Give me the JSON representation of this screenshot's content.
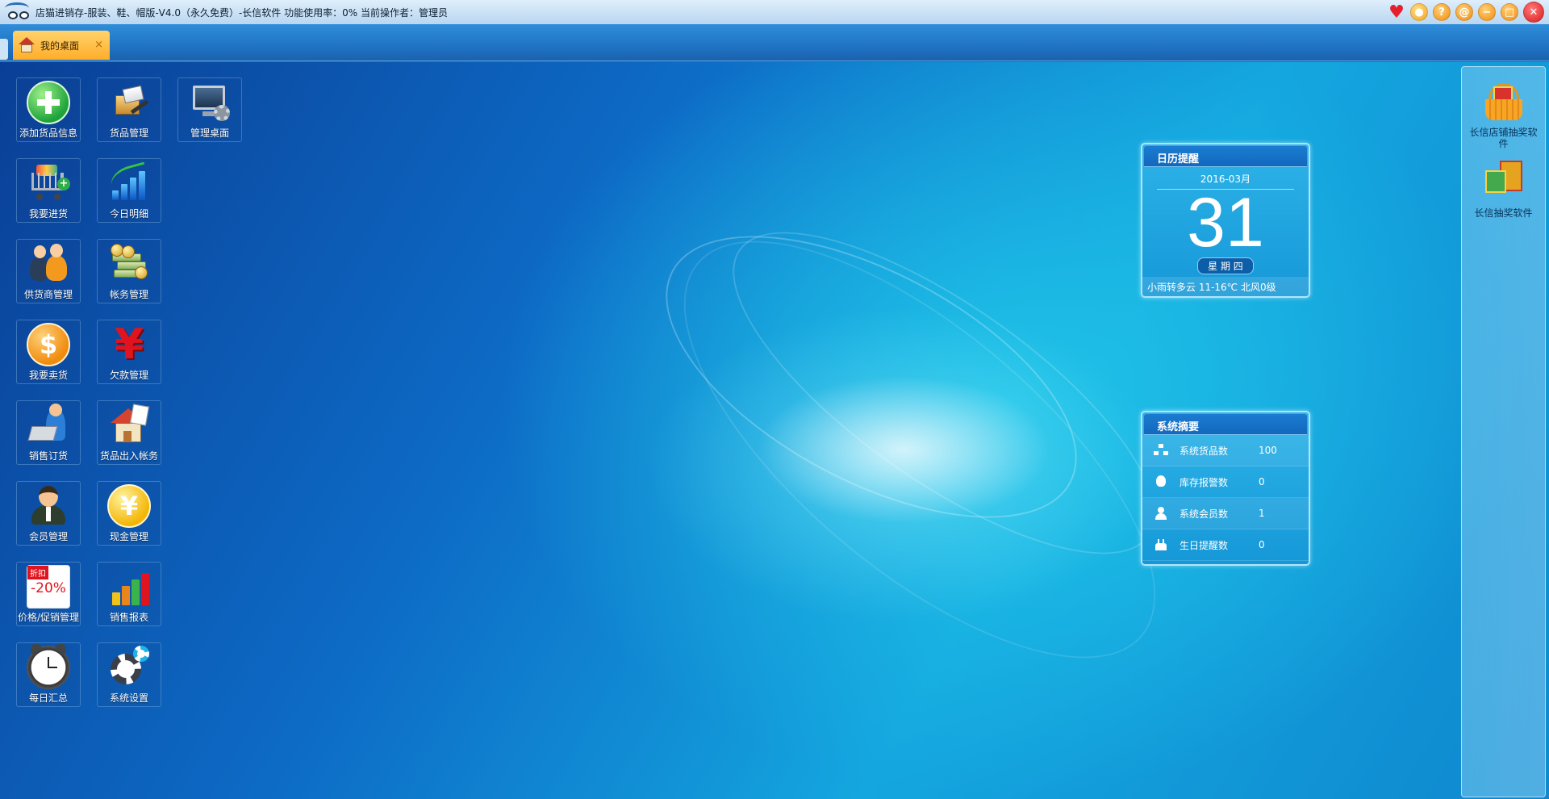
{
  "window": {
    "title": "店猫进销存-服装、鞋、帽版-V4.0（永久免费）-长信软件 功能使用率：0% 当前操作者：管理员",
    "controls": [
      "heart-icon",
      "bulb-icon",
      "help-icon",
      "at-icon",
      "minimize-icon",
      "maximize-icon",
      "close-icon"
    ]
  },
  "tabs": [
    {
      "label": "我的桌面",
      "close": "×"
    }
  ],
  "desktop_icons": [
    {
      "label": "添加货品信息",
      "icon": "add-icon"
    },
    {
      "label": "货品管理",
      "icon": "goods-icon"
    },
    {
      "label": "管理桌面",
      "icon": "monitor-gear-icon"
    },
    {
      "label": "我要进货",
      "icon": "cart-icon"
    },
    {
      "label": "今日明细",
      "icon": "bar-chart-icon"
    },
    {
      "label": "供货商管理",
      "icon": "people-icon"
    },
    {
      "label": "帐务管理",
      "icon": "money-icon"
    },
    {
      "label": "我要卖货",
      "icon": "dollar-icon"
    },
    {
      "label": "欠款管理",
      "icon": "yen-icon"
    },
    {
      "label": "销售订货",
      "icon": "order-icon"
    },
    {
      "label": "货品出入帐务",
      "icon": "house-icon"
    },
    {
      "label": "会员管理",
      "icon": "member-icon"
    },
    {
      "label": "现金管理",
      "icon": "cash-icon"
    },
    {
      "label": "价格/促销管理",
      "icon": "promo-icon",
      "tag": "折扣",
      "percent": "-20%"
    },
    {
      "label": "销售报表",
      "icon": "report-icon"
    },
    {
      "label": "每日汇总",
      "icon": "clock-icon"
    },
    {
      "label": "系统设置",
      "icon": "settings-icon"
    }
  ],
  "calendar": {
    "title": "日历提醒",
    "month": "2016-03月",
    "day": "31",
    "weekday": "星 期 四",
    "weather": "小雨转多云   11-16℃   北风0级"
  },
  "summary": {
    "title": "系统摘要",
    "rows": [
      {
        "label": "系统货品数",
        "value": "100",
        "icon": "network-icon"
      },
      {
        "label": "库存报警数",
        "value": "0",
        "icon": "bulb-icon"
      },
      {
        "label": "系统会员数",
        "value": "1",
        "icon": "user-icon"
      },
      {
        "label": "生日提醒数",
        "value": "0",
        "icon": "cake-icon"
      }
    ]
  },
  "right_panel": {
    "items": [
      {
        "label": "长信店铺抽奖软件",
        "icon": "gift-basket-icon"
      },
      {
        "label": "长信抽奖软件",
        "icon": "gift-boxes-icon"
      }
    ]
  },
  "colors": {
    "desktop_bg": "#0d6bc6",
    "tab_active": "#ffad2a",
    "widget_bg": "#1698d8"
  }
}
